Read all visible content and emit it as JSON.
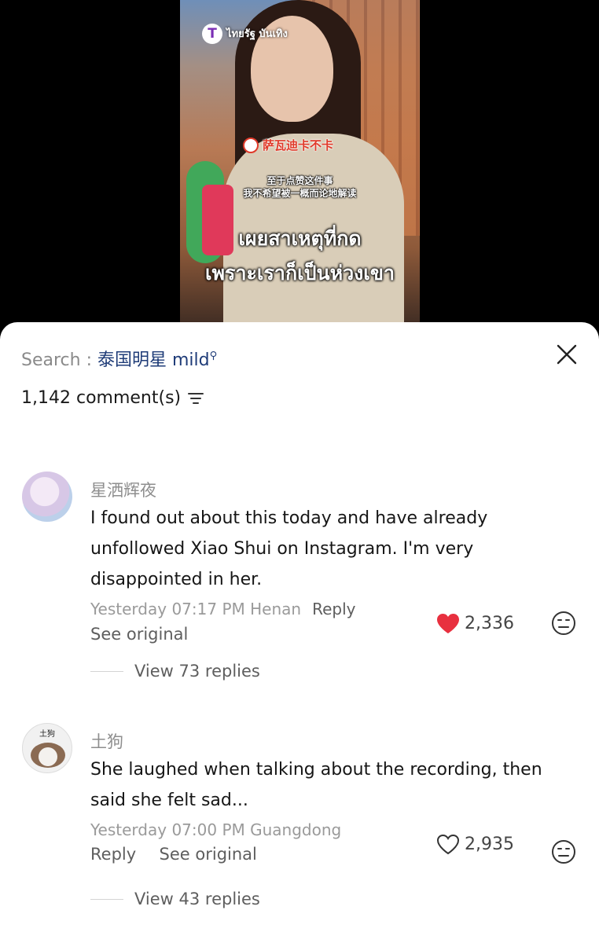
{
  "video": {
    "broadcaster_logo_text": "ไทยรัฐ บันเทิง",
    "translator_tag": "萨瓦迪卡不卡",
    "subtitle_cn_line1": "至于点赞这件事",
    "subtitle_cn_line2": "我不希望被一概而论地解读",
    "subtitle_th_line1": "เผยสาเหตุที่กด",
    "subtitle_th_line2": "เพราะเราก็เป็นห่วงเขา"
  },
  "sheet": {
    "search_label": "Search : ",
    "search_term": "泰国明星 mild",
    "comment_count": "1,142 comment(s)",
    "icons": {
      "close": "close-icon",
      "sort": "sort-icon",
      "search": "search-icon",
      "like": "heart-icon",
      "emoji": "emoji-icon"
    },
    "accent_color": "#e8303f"
  },
  "comments": [
    {
      "username": "星洒辉夜",
      "text": "I found out about this today and have already unfollowed Xiao Shui on Instagram. I'm very disappointed in her.",
      "timestamp": "Yesterday 07:17 PM Henan",
      "reply_label": "Reply",
      "see_original": "See original",
      "likes": "2,336",
      "liked": true,
      "view_replies": "View 73 replies"
    },
    {
      "username": "土狗",
      "avatar_label": "土狗",
      "text": "She laughed when talking about the recording, then said she felt sad...",
      "timestamp": "Yesterday 07:00 PM Guangdong",
      "reply_label": "Reply",
      "see_original": "See original",
      "likes": "2,935",
      "liked": false,
      "view_replies": "View 43 replies"
    }
  ]
}
